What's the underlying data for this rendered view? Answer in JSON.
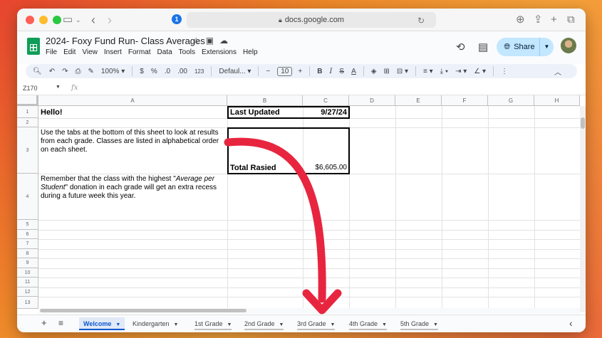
{
  "browser": {
    "url": "docs.google.com"
  },
  "doc": {
    "title": "2024- Foxy Fund Run- Class Averages",
    "menu": [
      "File",
      "Edit",
      "View",
      "Insert",
      "Format",
      "Data",
      "Tools",
      "Extensions",
      "Help"
    ],
    "share_label": "Share"
  },
  "toolbar": {
    "zoom": "100%",
    "currency": "$",
    "percent": "%",
    "dec_decrease": ".0",
    "dec_increase": ".00",
    "number_format": "123",
    "font": "Defaul...",
    "font_size": "10",
    "bold": "B",
    "italic": "I",
    "text_color": "A"
  },
  "formula_bar": {
    "cell_ref": "Z170",
    "fx": "fx"
  },
  "columns": [
    "A",
    "B",
    "C",
    "D",
    "E",
    "F",
    "G",
    "H"
  ],
  "rows": [
    "1",
    "2",
    "3",
    "4",
    "5",
    "6",
    "7",
    "8",
    "9",
    "10",
    "11",
    "12",
    "13"
  ],
  "cells": {
    "a1": "Hello!",
    "a3": "Use the tabs at the bottom of this sheet to look at results from each grade. Classes are listed in alphabetical order on each sheet.",
    "a4_pre": "Remember that the class with the highest \"",
    "a4_em": "Average per Student",
    "a4_post": "\" donation in each grade will get an extra recess during a future week this year.",
    "b1": "Last Updated",
    "c1": "9/27/24",
    "b3": "Total Rasied",
    "c3": "$6,605.00"
  },
  "sheet_tabs": [
    "Welcome",
    "Kindergarten",
    "1st Grade",
    "2nd Grade",
    "3rd Grade",
    "4th Grade",
    "5th Grade"
  ],
  "colors": {
    "accent": "#0b57d0",
    "share_bg": "#c2e7ff",
    "arrow": "#e8253f",
    "sheets_green": "#0f9d58"
  }
}
